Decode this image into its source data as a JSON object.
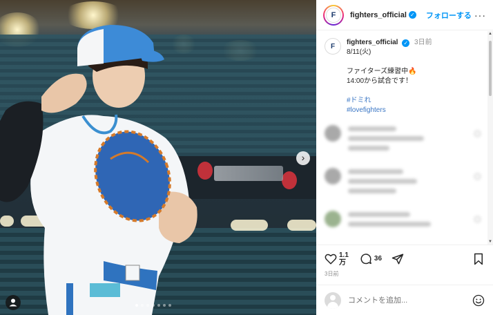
{
  "post": {
    "carousel_dots": 7,
    "carousel_active_index": 0
  },
  "header": {
    "username": "fighters_official",
    "follow_label": "フォローする",
    "more_label": "···",
    "logo_text": "F"
  },
  "caption": {
    "username": "fighters_official",
    "time": "3日前",
    "date_line": "8/11(火)",
    "line1": "ファイターズ練習中",
    "line2": "14:00から試合です！",
    "hashtag1": "#ドミれ",
    "hashtag2": "#lovefighters"
  },
  "actions": {
    "likes_line1": "1.1",
    "likes_line2": "万",
    "comments_count": "36",
    "posted_ago": "3日前"
  },
  "add_comment": {
    "placeholder": "コメントを追加..."
  },
  "colors": {
    "accent": "#0095f6",
    "hashtag": "#3a76c4"
  }
}
